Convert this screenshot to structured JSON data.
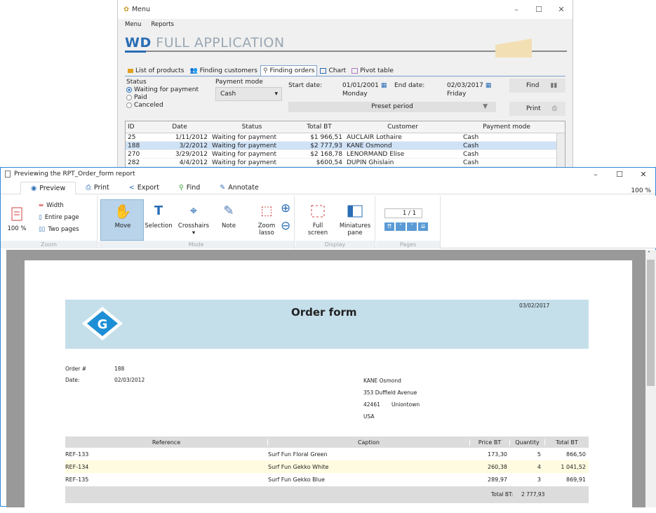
{
  "bg_window": {
    "title": "Menu",
    "menu": [
      "Menu",
      "Reports"
    ],
    "app_title_bold": "WD",
    "app_title_rest": " FULL APPLICATION",
    "tabs": [
      "List of products",
      "Finding customers",
      "Finding orders",
      "Chart",
      "Pivot table"
    ],
    "status_label": "Status",
    "status_options": [
      "Waiting for payment",
      "Paid",
      "Canceled"
    ],
    "payment_mode_label": "Payment mode",
    "payment_mode_value": "Cash",
    "start_date_label": "Start date:",
    "start_date_value": "01/01/2001",
    "start_day": "Monday",
    "end_date_label": "End date:",
    "end_date_value": "02/03/2017",
    "end_day": "Friday",
    "find_label": "Find",
    "preset_label": "Preset period",
    "print_label": "Print",
    "columns": [
      "ID",
      "Date",
      "Status",
      "Total BT",
      "Customer",
      "Payment mode"
    ],
    "rows": [
      {
        "id": "25",
        "date": "1/11/2012",
        "status": "Waiting for payment",
        "total": "$1 966,51",
        "customer": "AUCLAIR Lothaire",
        "mode": "Cash"
      },
      {
        "id": "188",
        "date": "3/2/2012",
        "status": "Waiting for payment",
        "total": "$2 777,93",
        "customer": "KANE Osmond",
        "mode": "Cash"
      },
      {
        "id": "270",
        "date": "3/29/2012",
        "status": "Waiting for payment",
        "total": "$2 168,78",
        "customer": "LENORMAND Elise",
        "mode": "Cash"
      },
      {
        "id": "282",
        "date": "4/4/2012",
        "status": "Waiting for payment",
        "total": "$600,54",
        "customer": "DUPIN Ghislain",
        "mode": "Cash"
      }
    ]
  },
  "preview": {
    "title": "Previewing the RPT_Order_form report",
    "tabs": [
      "Preview",
      "Print",
      "Export",
      "Find",
      "Annotate"
    ],
    "zoom_display": "100 %",
    "zoom_group": {
      "width": "Width",
      "entire_page": "Entire page",
      "two_pages": "Two pages",
      "zoom_value": "100 %",
      "label": "Zoom"
    },
    "mode_group": {
      "move": "Move",
      "selection": "Selection",
      "crosshairs": "Crosshairs",
      "note": "Note",
      "zoom_lasso_1": "Zoom",
      "zoom_lasso_2": "lasso",
      "label": "Mode"
    },
    "display_group": {
      "full_screen": "Full screen",
      "miniatures_1": "Miniatures",
      "miniatures_2": "pane",
      "label": "Display"
    },
    "pages_group": {
      "page_counter": "1 / 1",
      "label": "Pages"
    }
  },
  "report": {
    "title": "Order form",
    "date": "03/02/2017",
    "order_label": "Order #",
    "order_value": "188",
    "date_label": "Date:",
    "date_value": "02/03/2012",
    "customer_name": "KANE Osmond",
    "address_line": "353 Duffield Avenue",
    "zip": "42461",
    "city": "Uniontown",
    "country": "USA",
    "columns": [
      "Reference",
      "Caption",
      "Price BT",
      "Quantity",
      "Total BT"
    ],
    "lines": [
      {
        "ref": "REF-133",
        "caption": "Surf Fun Floral Green",
        "price": "173,30",
        "qty": "5",
        "total": "866,50"
      },
      {
        "ref": "REF-134",
        "caption": "Surf Fun Gekko White",
        "price": "260,38",
        "qty": "4",
        "total": "1 041,52"
      },
      {
        "ref": "REF-135",
        "caption": "Surf Fun Gekko Blue",
        "price": "289,97",
        "qty": "3",
        "total": "869,91"
      }
    ],
    "total_label": "Total BT:",
    "total_value": "2 777,93"
  }
}
